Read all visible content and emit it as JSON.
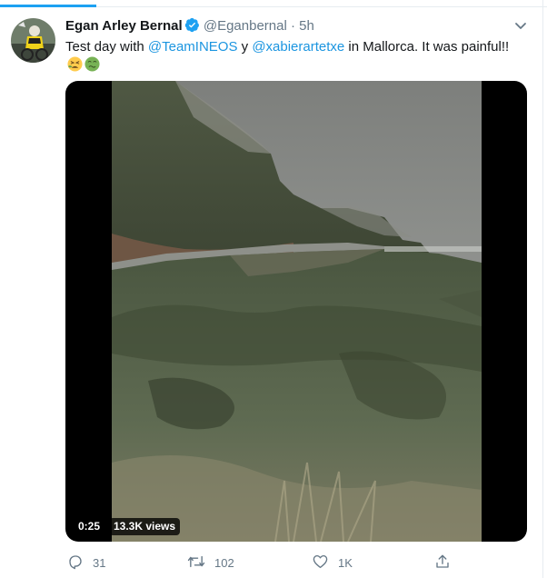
{
  "tweet": {
    "author_name": "Egan Arley Bernal",
    "verified_icon": "verified-badge-icon",
    "handle": "@Eganbernal",
    "separator": "·",
    "time": "5h",
    "text_parts": {
      "prefix": "Test day with ",
      "mention1": "@TeamINEOS",
      "middle": " y ",
      "mention2": "@xabierartetxe",
      "suffix": " in Mallorca. It was painful!!"
    },
    "emojis": [
      "tired-face-emoji",
      "nauseated-face-emoji"
    ]
  },
  "media": {
    "duration": "0:25",
    "views": "13.3K views"
  },
  "actions": {
    "reply_count": "31",
    "retweet_count": "102",
    "like_count": "1K"
  },
  "colors": {
    "accent": "#1da1f2",
    "mention": "#1b95e0",
    "muted": "#657786",
    "text": "#14171a"
  }
}
